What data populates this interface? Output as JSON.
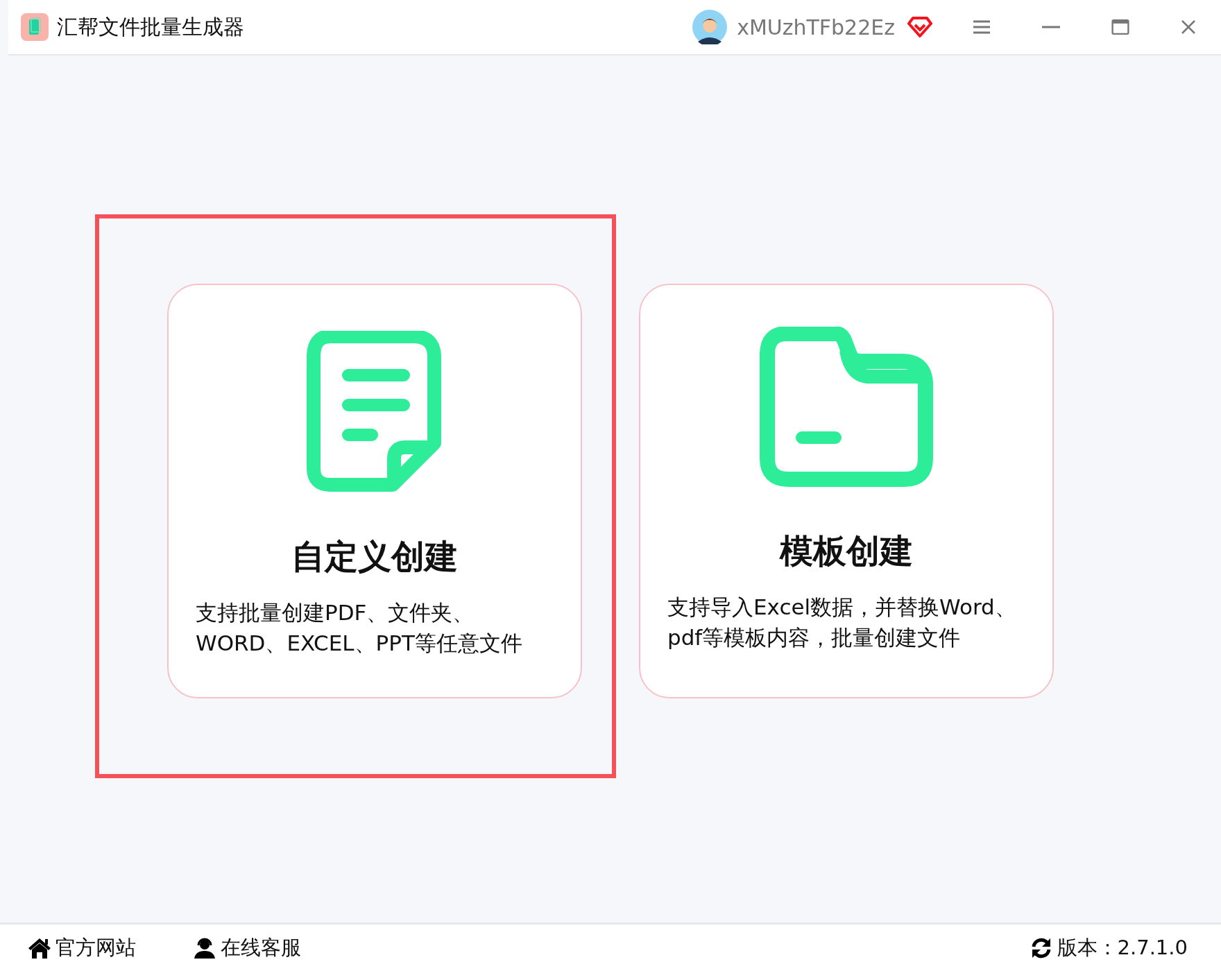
{
  "window": {
    "title": "汇帮文件批量生成器",
    "user": "xMUzhTFb22Ez"
  },
  "cards": [
    {
      "kind": "document",
      "title": "自定义创建",
      "description": "支持批量创建PDF、文件夹、WORD、EXCEL、PPT等任意文件",
      "highlighted": true
    },
    {
      "kind": "folder",
      "title": "模板创建",
      "description": "支持导入Excel数据，并替换Word、pdf等模板内容，批量创建文件",
      "highlighted": false
    }
  ],
  "footer": {
    "links": [
      {
        "kind": "home",
        "label": "官方网站"
      },
      {
        "kind": "support",
        "label": "在线客服"
      }
    ],
    "version": "版本：2.7.1.0"
  }
}
